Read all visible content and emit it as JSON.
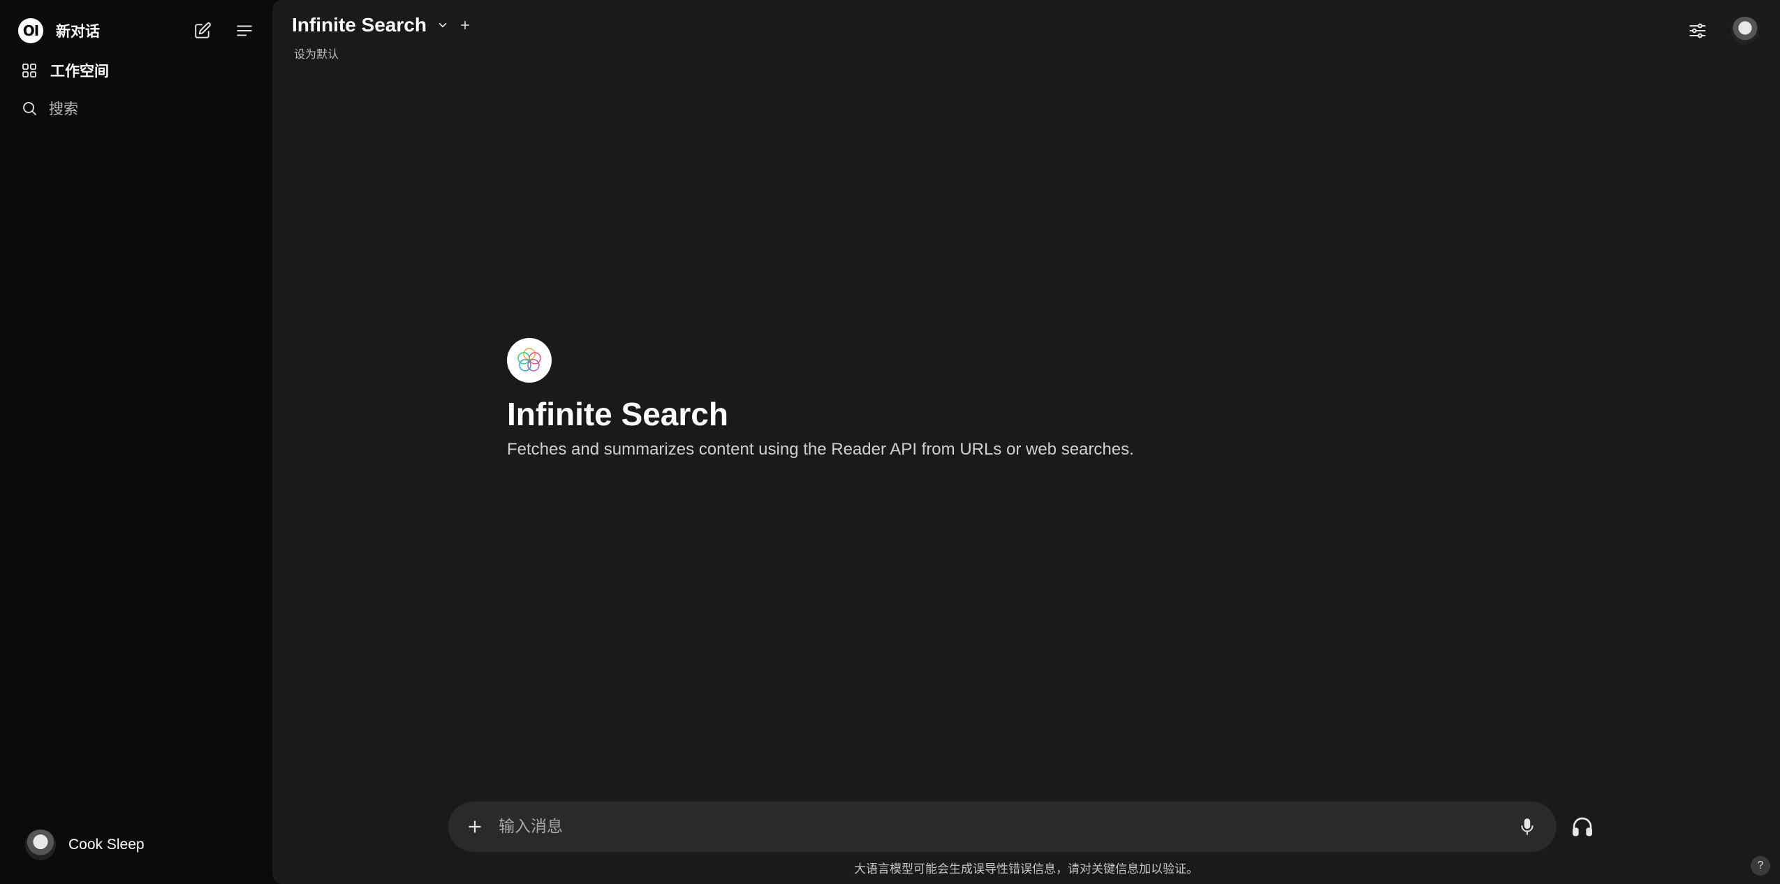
{
  "sidebar": {
    "logo_text": "OI",
    "new_chat_label": "新对话",
    "items": [
      {
        "label": "工作空间",
        "icon": "grid-icon"
      },
      {
        "label": "搜索",
        "icon": "search-icon"
      }
    ],
    "user": {
      "name": "Cook Sleep"
    }
  },
  "header": {
    "model_name": "Infinite Search",
    "set_default": "设为默认"
  },
  "hero": {
    "title": "Infinite Search",
    "description": "Fetches and summarizes content using the Reader API from URLs or web searches."
  },
  "composer": {
    "placeholder": "输入消息"
  },
  "footer": {
    "disclaimer": "大语言模型可能会生成误导性错误信息，请对关键信息加以验证。",
    "help": "?"
  },
  "colors": {
    "sidebar_bg": "#0b0b0b",
    "main_bg": "#1a1a1a",
    "composer_bg": "#2a2a2a"
  }
}
